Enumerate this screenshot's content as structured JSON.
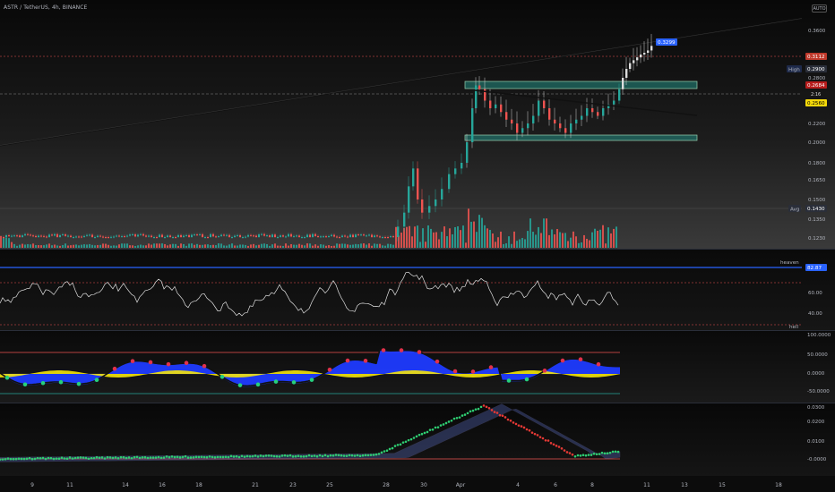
{
  "header": {
    "symbol_title": "ASTR / TetherUS, 4h, BINANCE",
    "auto_label": "AUTO"
  },
  "price_axis": {
    "labels": [
      "0.3600",
      "0.2900",
      "0.2800",
      "0.2200",
      "0.2000",
      "0.1800",
      "0.1650",
      "0.1500",
      "0.1350",
      "0.1230"
    ],
    "current_price": "0.3299",
    "tag_red": "0.3112",
    "high_label": "High",
    "high_value": "0.2900",
    "tag_mid": "0.2684",
    "tag_sub": "2:16",
    "tag_yellow": "0.2560",
    "avg_label": "Avg",
    "avg_value": "0.1430",
    "colors": {
      "up": "#26a69a",
      "down": "#ef5350",
      "accent": "#2962ff",
      "yellow": "#f5d90a"
    }
  },
  "rsi_pane": {
    "heaven_label": "heaven",
    "heaven_value": "82.87",
    "hell_label": "hell",
    "axis": [
      "60.00",
      "40.00"
    ]
  },
  "wave_pane": {
    "axis": [
      "100.0000",
      "50.0000",
      "0.0000",
      "-50.0000"
    ]
  },
  "osc_pane": {
    "axis": [
      "0.0300",
      "0.0200",
      "0.0100",
      "-0.0000"
    ]
  },
  "time_axis": {
    "labels": [
      "9",
      "11",
      "14",
      "16",
      "18",
      "21",
      "23",
      "25",
      "28",
      "30",
      "Apr",
      "4",
      "6",
      "8",
      "11",
      "13",
      "15",
      "18"
    ]
  }
}
